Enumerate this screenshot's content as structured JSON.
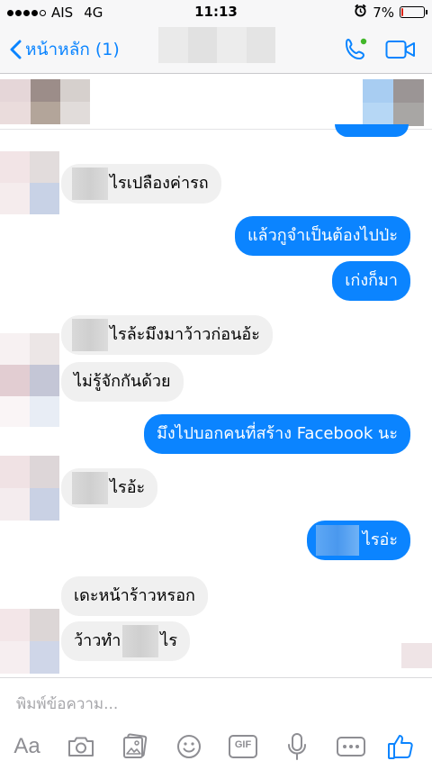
{
  "status_bar": {
    "carrier": "AIS",
    "network": "4G",
    "time": "11:13",
    "battery_percent": "7%",
    "battery_level": 0.07,
    "signal_dots_filled": 4
  },
  "nav": {
    "back_label": "หน้าหลัก (1)",
    "accent_color": "#0a84ff",
    "online_color": "#42b72a"
  },
  "messages": [
    {
      "id": "m1",
      "side": "in",
      "text": "ไรเปลืองค่ารถ",
      "redacted_prefix": true
    },
    {
      "id": "m2",
      "side": "out",
      "text": "แล้วกูจำเป็นต้องไปป่ะ"
    },
    {
      "id": "m3",
      "side": "out",
      "text": "เก่งก็มา"
    },
    {
      "id": "m4",
      "side": "in",
      "text": "ไรล้ะมึงมาว้าวก่อนอ้ะ",
      "redacted_prefix": true
    },
    {
      "id": "m5",
      "side": "in",
      "text": "ไม่รู้จักกันด้วย"
    },
    {
      "id": "m6",
      "side": "out",
      "text": "มึงไปบอกคนที่สร้าง Facebook นะ"
    },
    {
      "id": "m7",
      "side": "in",
      "text": "ไรอ้ะ",
      "redacted_prefix": true
    },
    {
      "id": "m8",
      "side": "out",
      "text": "ไรอ่ะ",
      "redacted_prefix": true
    },
    {
      "id": "m9",
      "side": "in",
      "text": "เดะหน้าร้าวหรอก"
    },
    {
      "id": "m10",
      "side": "in",
      "text_before": "ว้าวทำ",
      "text_after": "ไร",
      "redacted_middle": true
    }
  ],
  "composer": {
    "placeholder": "พิมพ์ข้อความ...",
    "toolbar": [
      {
        "name": "text-size",
        "label": "Aa",
        "icon": "aa-icon"
      },
      {
        "name": "camera",
        "icon": "camera-icon"
      },
      {
        "name": "gallery",
        "icon": "gallery-icon"
      },
      {
        "name": "emoji",
        "icon": "emoji-icon"
      },
      {
        "name": "gif",
        "label": "GIF",
        "icon": "gif-icon"
      },
      {
        "name": "microphone",
        "icon": "microphone-icon"
      },
      {
        "name": "more",
        "icon": "more-icon"
      },
      {
        "name": "like",
        "icon": "thumbs-up-icon"
      }
    ]
  },
  "colors": {
    "outgoing_bubble": "#0b84ff",
    "incoming_bubble": "#f0f0f0",
    "toolbar_icon": "#8e8e93"
  }
}
